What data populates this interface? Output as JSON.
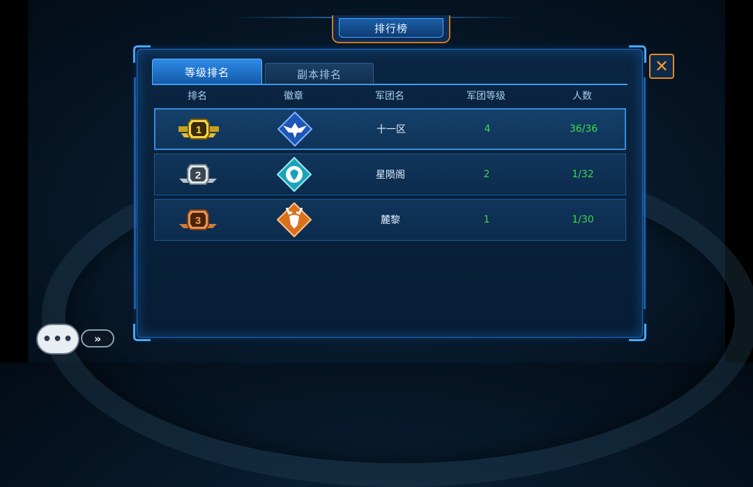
{
  "window": {
    "title": "排行榜"
  },
  "tabs": [
    {
      "label": "等级排名",
      "active": true
    },
    {
      "label": "副本排名",
      "active": false
    }
  ],
  "table": {
    "headers": [
      "排名",
      "徽章",
      "军团名",
      "军团等级",
      "人数"
    ],
    "rows": [
      {
        "rank": "1",
        "rank_badge": "gold-rank-badge",
        "emblem": "eagle-emblem-icon",
        "name": "十一区",
        "level": "4",
        "members": "36/36"
      },
      {
        "rank": "2",
        "rank_badge": "silver-rank-badge",
        "emblem": "lion-emblem-icon",
        "name": "星陨阁",
        "level": "2",
        "members": "1/32"
      },
      {
        "rank": "3",
        "rank_badge": "bronze-rank-badge",
        "emblem": "deer-emblem-icon",
        "name": "麓黎",
        "level": "1",
        "members": "1/30"
      }
    ]
  },
  "controls": {
    "close_icon": "close-icon",
    "chat_icon": "chat-bubble-icon",
    "expand_icon": "double-chevron-right-icon"
  },
  "colors": {
    "accent": "#2d8ae8",
    "close": "#e88a1e",
    "value_green": "#3fdc4a"
  }
}
